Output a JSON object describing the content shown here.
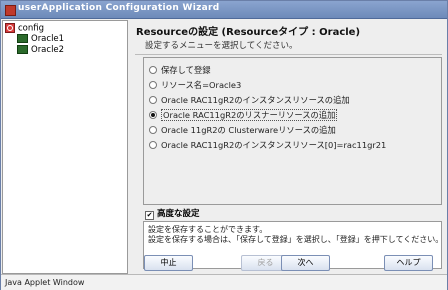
{
  "window": {
    "title": "userApplication Configuration Wizard"
  },
  "tree": {
    "root": "config",
    "children": [
      "Oracle1",
      "Oracle2"
    ]
  },
  "panel": {
    "heading": "Resourceの設定 (Resourceタイプ : Oracle)",
    "subtitle": "設定するメニューを選択してください。",
    "options": [
      "保存して登録",
      "リソース名=Oracle3",
      "Oracle RAC11gR2のインスタンスリソースの追加",
      "Oracle RAC11gR2のリスナーリソースの追加",
      "Oracle 11gR2の Clusterwareリソースの追加",
      "Oracle RAC11gR2のインスタンスリソース[0]=rac11gr21"
    ],
    "selected_index": 3,
    "advanced_label": "高度な設定",
    "advanced_checked": true,
    "description_lines": [
      "設定を保存することができます。",
      "設定を保存する場合は、「保存して登録」を選択し、「登録」を押下してください。"
    ]
  },
  "buttons": {
    "cancel": "中止",
    "back": "戻る",
    "next": "次へ",
    "help": "ヘルプ"
  },
  "status_bar": "Java Applet Window"
}
